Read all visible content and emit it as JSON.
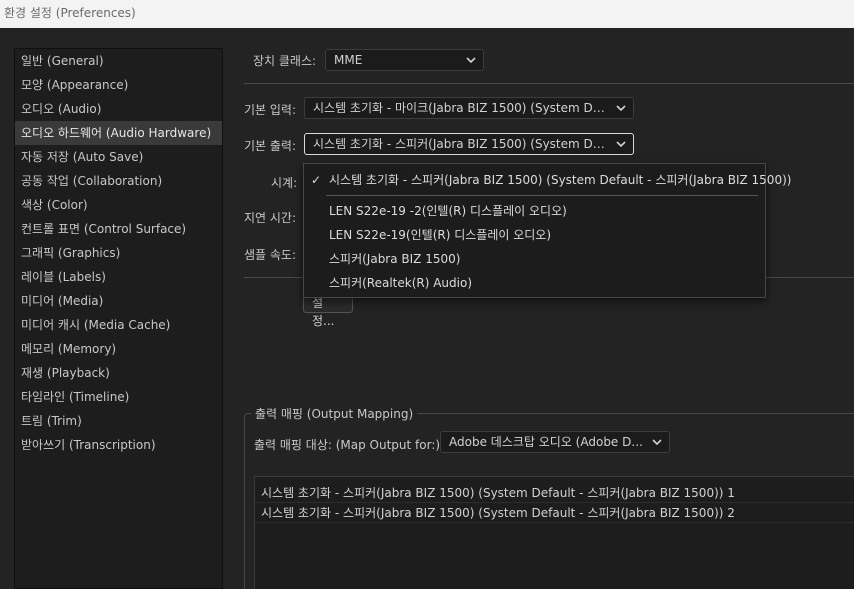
{
  "window": {
    "title": "환경 설정 (Preferences)"
  },
  "sidebar": {
    "items": [
      {
        "label": "일반 (General)"
      },
      {
        "label": "모양 (Appearance)"
      },
      {
        "label": "오디오 (Audio)"
      },
      {
        "label": "오디오 하드웨어 (Audio Hardware)",
        "selected": true
      },
      {
        "label": "자동 저장 (Auto Save)"
      },
      {
        "label": "공동 작업 (Collaboration)"
      },
      {
        "label": "색상 (Color)"
      },
      {
        "label": "컨트롤 표면 (Control Surface)"
      },
      {
        "label": "그래픽 (Graphics)"
      },
      {
        "label": "레이블 (Labels)"
      },
      {
        "label": "미디어 (Media)"
      },
      {
        "label": "미디어 캐시 (Media Cache)"
      },
      {
        "label": "메모리 (Memory)"
      },
      {
        "label": "재생 (Playback)"
      },
      {
        "label": "타임라인 (Timeline)"
      },
      {
        "label": "트림 (Trim)"
      },
      {
        "label": "받아쓰기 (Transcription)"
      }
    ]
  },
  "device_class": {
    "label": "장치 클래스:",
    "value": "MME"
  },
  "default_input": {
    "label": "기본 입력:",
    "value": "시스템 초기화 - 마이크(Jabra BIZ 1500) (System Defau..."
  },
  "default_output": {
    "label": "기본 출력:",
    "value": "시스템 초기화 - 스피커(Jabra BIZ 1500) (System Defau..."
  },
  "clock": {
    "label": "시계:"
  },
  "latency": {
    "label": "지연 시간:"
  },
  "sample_rate": {
    "label": "샘플 속도:"
  },
  "settings_button": {
    "label": "설정..."
  },
  "output_dropdown": {
    "checked_item": "시스템 초기화 - 스피커(Jabra BIZ 1500) (System Default - 스피커(Jabra BIZ 1500))",
    "items": [
      "LEN S22e-19 -2(인텔(R) 디스플레이 오디오)",
      "LEN S22e-19(인텔(R) 디스플레이 오디오)",
      "스피커(Jabra BIZ 1500)",
      "스피커(Realtek(R) Audio)"
    ]
  },
  "output_mapping": {
    "group_title": "출력 매핑 (Output Mapping)",
    "target_label": "출력 매핑 대상: (Map Output for:)",
    "target_value": "Adobe 데스크탑 오디오 (Adobe D...",
    "rows": [
      "시스템 초기화 - 스피커(Jabra BIZ 1500) (System Default - 스피커(Jabra BIZ 1500)) 1",
      "시스템 초기화 - 스피커(Jabra BIZ 1500) (System Default - 스피커(Jabra BIZ 1500)) 2"
    ]
  }
}
